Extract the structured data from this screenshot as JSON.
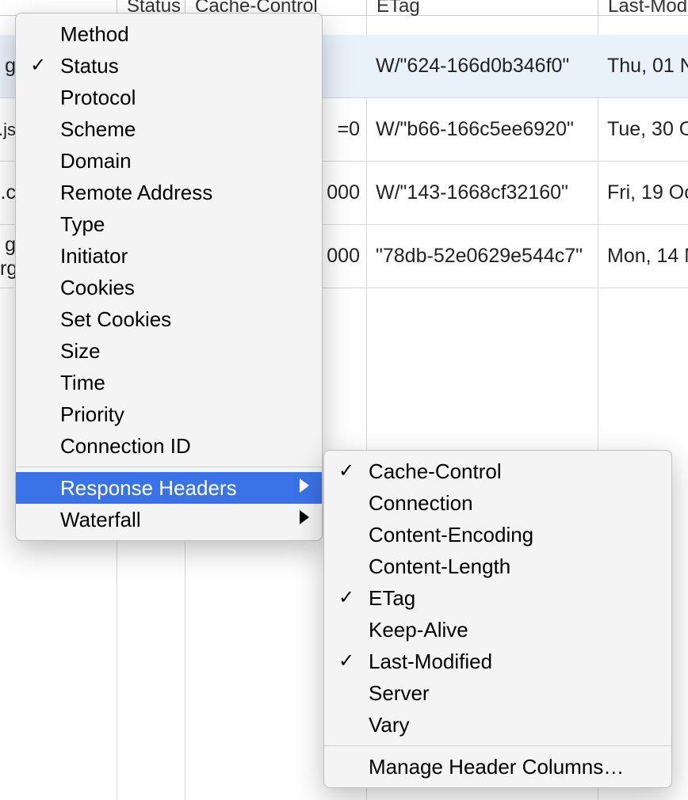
{
  "columns": {
    "status": "Status",
    "cache_control": "Cache-Control",
    "etag": "ETag",
    "last_modified": "Last-Mod"
  },
  "rows": [
    {
      "name_frag": "g",
      "cache_frag": "",
      "etag": "W/\"624-166d0b346f0\"",
      "last_modified": "Thu, 01 N"
    },
    {
      "name_frag": ".js",
      "cache_frag": "=0",
      "etag": "W/\"b66-166c5ee6920\"",
      "last_modified": "Tue, 30 O"
    },
    {
      "name_frag": ".c",
      "cache_frag": "000",
      "etag": "W/\"143-1668cf32160\"",
      "last_modified": "Fri, 19 Oc"
    },
    {
      "name_frag": "g\nrg",
      "cache_frag": "000",
      "etag": "\"78db-52e0629e544c7\"",
      "last_modified": "Mon, 14 M"
    }
  ],
  "menu": {
    "items": [
      {
        "label": "Method",
        "checked": false
      },
      {
        "label": "Status",
        "checked": true
      },
      {
        "label": "Protocol",
        "checked": false
      },
      {
        "label": "Scheme",
        "checked": false
      },
      {
        "label": "Domain",
        "checked": false
      },
      {
        "label": "Remote Address",
        "checked": false
      },
      {
        "label": "Type",
        "checked": false
      },
      {
        "label": "Initiator",
        "checked": false
      },
      {
        "label": "Cookies",
        "checked": false
      },
      {
        "label": "Set Cookies",
        "checked": false
      },
      {
        "label": "Size",
        "checked": false
      },
      {
        "label": "Time",
        "checked": false
      },
      {
        "label": "Priority",
        "checked": false
      },
      {
        "label": "Connection ID",
        "checked": false
      }
    ],
    "response_headers": "Response Headers",
    "waterfall": "Waterfall"
  },
  "submenu": {
    "items": [
      {
        "label": "Cache-Control",
        "checked": true
      },
      {
        "label": "Connection",
        "checked": false
      },
      {
        "label": "Content-Encoding",
        "checked": false
      },
      {
        "label": "Content-Length",
        "checked": false
      },
      {
        "label": "ETag",
        "checked": true
      },
      {
        "label": "Keep-Alive",
        "checked": false
      },
      {
        "label": "Last-Modified",
        "checked": true
      },
      {
        "label": "Server",
        "checked": false
      },
      {
        "label": "Vary",
        "checked": false
      }
    ],
    "manage": "Manage Header Columns…"
  }
}
